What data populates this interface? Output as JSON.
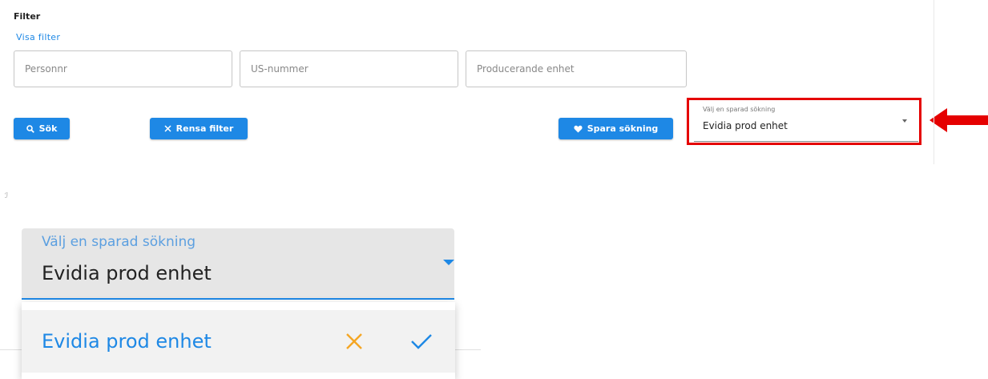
{
  "filter": {
    "title": "Filter",
    "toggle_label": "Visa filter"
  },
  "fields": {
    "personnr_placeholder": "Personnr",
    "us_nummer_placeholder": "US-nummer",
    "producerande_enhet_placeholder": "Producerande enhet"
  },
  "buttons": {
    "search_label": "Sök",
    "clear_label": "Rensa filter",
    "save_label": "Spara sökning"
  },
  "saved_search": {
    "label": "Välj en sparad sökning",
    "selected": "Evidia prod enhet"
  },
  "zoomed_dropdown": {
    "label": "Välj en sparad sökning",
    "selected": "Evidia prod enhet",
    "options": [
      "Evidia prod enhet"
    ]
  },
  "annotation": {
    "stray_mark": "ℐ"
  },
  "colors": {
    "accent": "#1e88e5",
    "highlight": "#e50000",
    "delete_icon": "#f5a623"
  },
  "icons": [
    "search-icon",
    "close-icon",
    "heart-icon",
    "caret-down-icon",
    "arrow-left-icon",
    "delete-icon",
    "check-icon"
  ]
}
